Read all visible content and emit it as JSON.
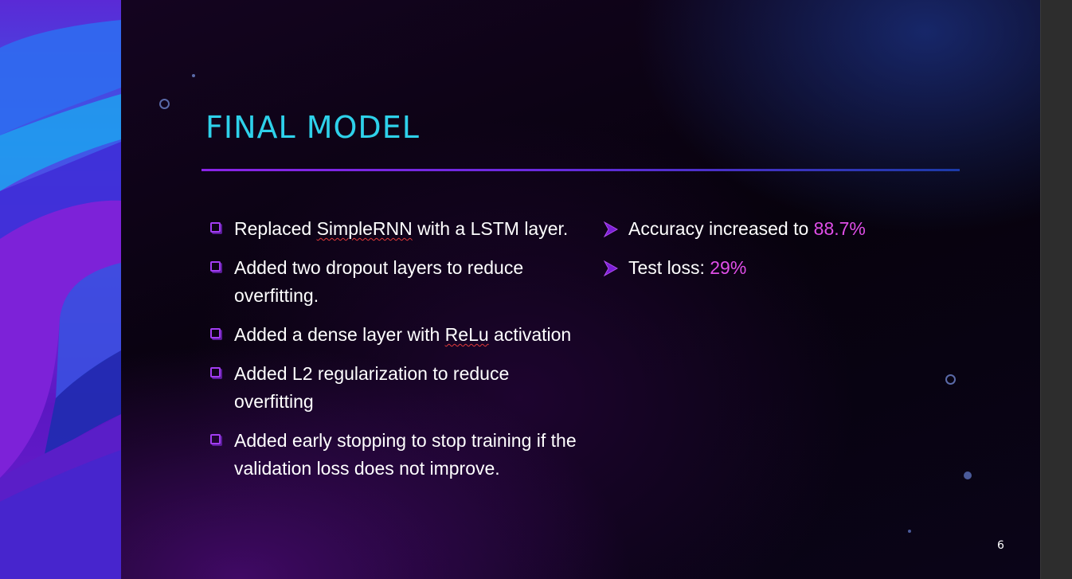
{
  "slide": {
    "title": "FINAL MODEL",
    "page_number": "6",
    "accent_color": "#e04ee8",
    "title_color": "#2ed1ea"
  },
  "left_bullets": [
    {
      "icon": "checkbox-square-icon",
      "before": "Replaced ",
      "flagged": "SimpleRNN",
      "after": " with a LSTM layer."
    },
    {
      "icon": "checkbox-square-icon",
      "text": "Added two dropout layers to reduce overfitting."
    },
    {
      "icon": "checkbox-square-icon",
      "before": "Added a dense layer with ",
      "flagged": "ReLu",
      "after": " activation"
    },
    {
      "icon": "checkbox-square-icon",
      "text": "Added L2 regularization to reduce overfitting"
    },
    {
      "icon": "checkbox-square-icon",
      "text": "Added early stopping to stop training if the validation loss does not improve."
    }
  ],
  "right_bullets": [
    {
      "icon": "arrow-bullet-icon",
      "label": "Accuracy increased to ",
      "value": "88.7%"
    },
    {
      "icon": "arrow-bullet-icon",
      "label": "Test loss: ",
      "value": "29%"
    }
  ]
}
